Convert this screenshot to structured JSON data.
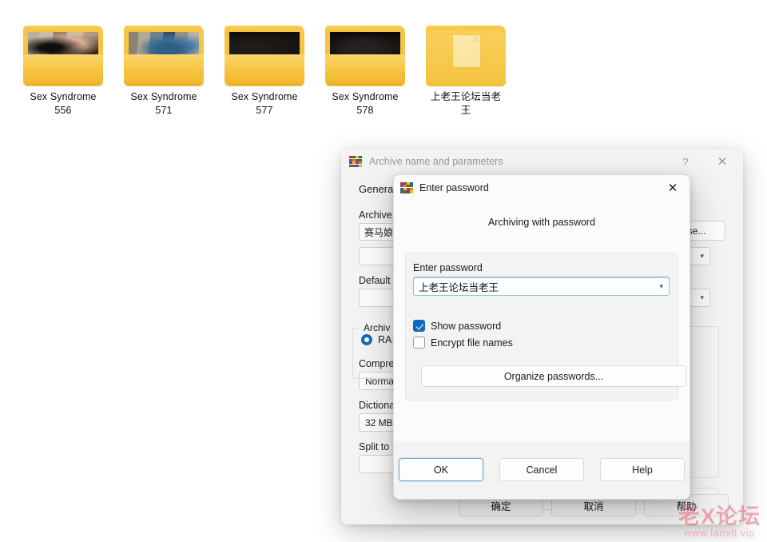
{
  "desktop": {
    "folders": [
      {
        "name_line1": "Sex Syndrome",
        "name_line2": "556",
        "thumb": "photo-cat",
        "icon": "folder-icon"
      },
      {
        "name_line1": "Sex Syndrome",
        "name_line2": "571",
        "thumb": "photo-window",
        "icon": "folder-icon"
      },
      {
        "name_line1": "Sex Syndrome",
        "name_line2": "577",
        "thumb": "photo-dark",
        "icon": "folder-icon"
      },
      {
        "name_line1": "Sex Syndrome",
        "name_line2": "578",
        "thumb": "photo-dark",
        "icon": "folder-icon"
      },
      {
        "name_line1": "上老王论坛当老",
        "name_line2": "王",
        "thumb": "document-sheet",
        "icon": "folder-icon"
      }
    ]
  },
  "main_dialog": {
    "title": "Archive name and parameters",
    "app_icon": "winrar-icon",
    "help_button": "?",
    "close_button": "✕",
    "tabs": [
      {
        "label": "General"
      }
    ],
    "archive_name_label": "Archive",
    "archive_name_value": "赛马娘",
    "browse_button": "se...",
    "default_label": "Default",
    "default_value": "",
    "archive_format_label": "Archiv",
    "format_radio_label": "RA",
    "compression_label": "Compre",
    "compression_value": "Norma",
    "dictionary_label": "Dictiona",
    "dictionary_value": "32 MB",
    "split_label": "Split to",
    "split_value": "",
    "footer": {
      "ok": "确定",
      "cancel": "取消",
      "help": "帮助"
    }
  },
  "password_dialog": {
    "title": "Enter password",
    "app_icon": "winrar-icon",
    "close_button": "✕",
    "heading": "Archiving with password",
    "enter_password_label": "Enter password",
    "password_value": "上老王论坛当老王",
    "password_dropdown_icon": "chevron-down-icon",
    "show_password": {
      "label": "Show password",
      "checked": true
    },
    "encrypt_file_names": {
      "label": "Encrypt file names",
      "checked": false
    },
    "organize_button": "Organize passwords...",
    "buttons": {
      "ok": "OK",
      "cancel": "Cancel",
      "help": "Help"
    }
  },
  "watermark": {
    "main": "老X论坛",
    "sub": "www.laoxlt.vip"
  },
  "colors": {
    "accent": "#0f6cbd",
    "folder_yellow": "#f5c23c",
    "dialog_bg": "#f3f3f3",
    "watermark": "#e43c5a"
  }
}
